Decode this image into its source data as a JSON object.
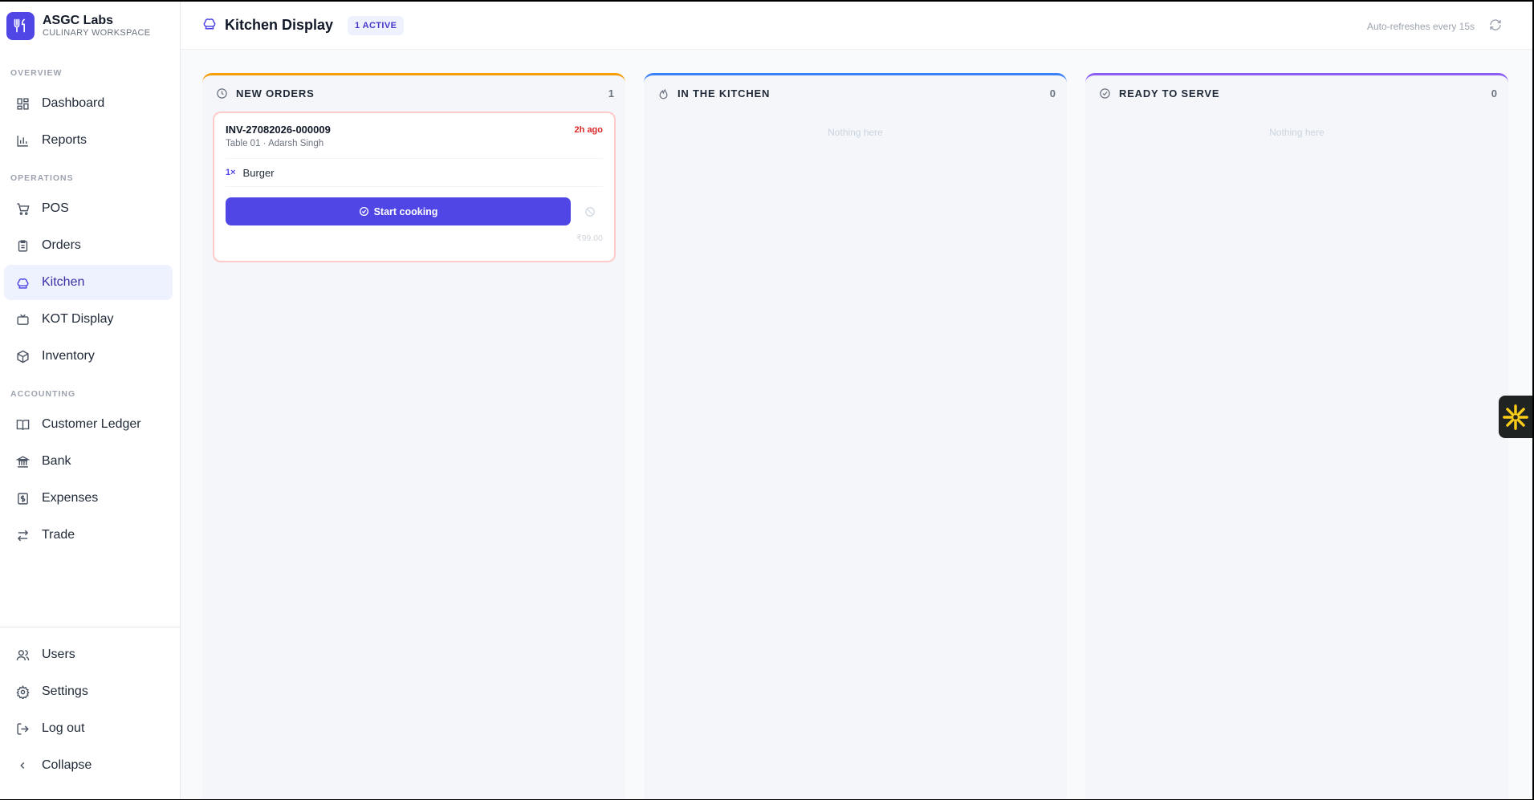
{
  "brand": {
    "name": "ASGC Labs",
    "subtitle": "CULINARY WORKSPACE"
  },
  "sidebar": {
    "sections": [
      {
        "label": "OVERVIEW",
        "items": [
          {
            "label": "Dashboard",
            "icon": "dashboard-icon"
          },
          {
            "label": "Reports",
            "icon": "bar-chart-icon"
          }
        ]
      },
      {
        "label": "OPERATIONS",
        "items": [
          {
            "label": "POS",
            "icon": "cart-icon"
          },
          {
            "label": "Orders",
            "icon": "clipboard-icon"
          },
          {
            "label": "Kitchen",
            "icon": "chef-hat-icon",
            "active": true
          },
          {
            "label": "KOT Display",
            "icon": "tv-icon"
          },
          {
            "label": "Inventory",
            "icon": "package-icon"
          }
        ]
      },
      {
        "label": "ACCOUNTING",
        "items": [
          {
            "label": "Customer Ledger",
            "icon": "book-icon"
          },
          {
            "label": "Bank",
            "icon": "bank-icon"
          },
          {
            "label": "Expenses",
            "icon": "receipt-icon"
          },
          {
            "label": "Trade",
            "icon": "arrows-icon"
          }
        ]
      }
    ],
    "footer": [
      {
        "label": "Users",
        "icon": "users-icon"
      },
      {
        "label": "Settings",
        "icon": "gear-icon"
      },
      {
        "label": "Log out",
        "icon": "logout-icon"
      },
      {
        "label": "Collapse",
        "icon": "chevron-left-icon"
      }
    ]
  },
  "header": {
    "title": "Kitchen Display",
    "badge": "1 ACTIVE",
    "auto_refresh": "Auto-refreshes every 15s"
  },
  "columns": [
    {
      "title": "NEW ORDERS",
      "count": "1",
      "accent": "#f59e0b",
      "icon": "clock-icon"
    },
    {
      "title": "IN THE KITCHEN",
      "count": "0",
      "accent": "#3b82f6",
      "icon": "flame-icon",
      "empty_text": "Nothing here"
    },
    {
      "title": "READY TO SERVE",
      "count": "0",
      "accent": "#8b5cf6",
      "icon": "check-circle-icon",
      "empty_text": "Nothing here"
    }
  ],
  "order": {
    "id": "INV-27082026-000009",
    "time": "2h ago",
    "meta": "Table 01 · Adarsh Singh",
    "items": [
      {
        "qty": "1×",
        "name": "Burger"
      }
    ],
    "action_label": "Start cooking",
    "total": "₹99.00"
  },
  "colors": {
    "primary": "#4f46e5",
    "alert": "#dc2626",
    "widget": "#facc15"
  }
}
